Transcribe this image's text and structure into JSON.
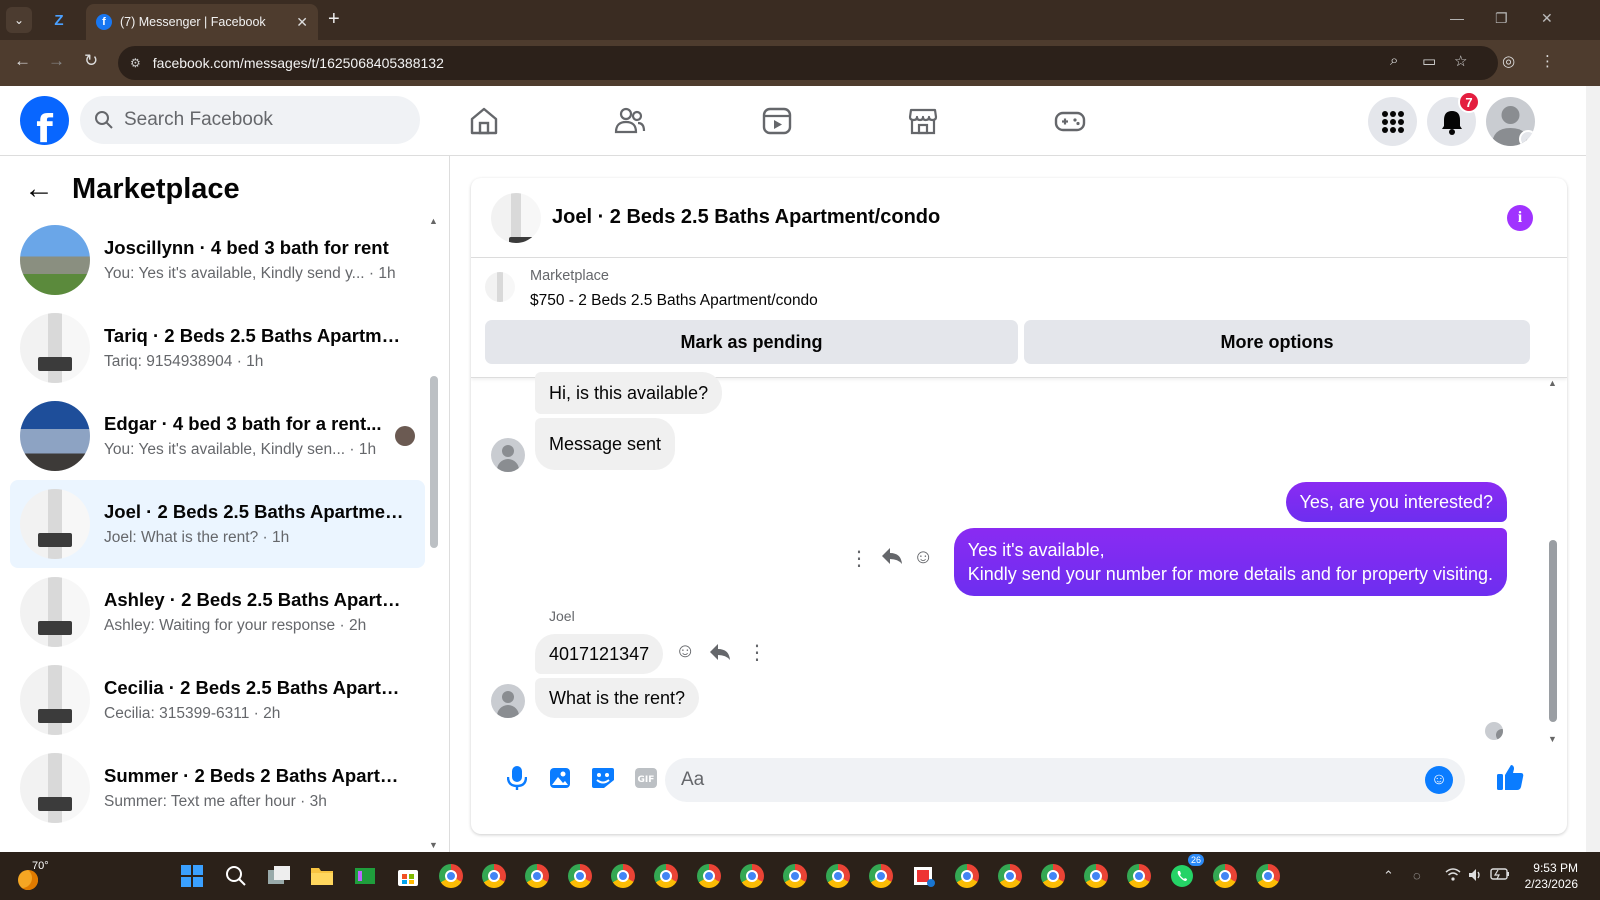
{
  "browser": {
    "tab_title": "(7) Messenger | Facebook",
    "url": "facebook.com/messages/t/1625068405388132"
  },
  "header": {
    "search_placeholder": "Search Facebook",
    "notification_count": "7"
  },
  "sidebar": {
    "title": "Marketplace",
    "conversations": [
      {
        "name": "Joscillynn · 4 bed 3 bath for rent",
        "preview": "You: Yes it's available, Kindly send y...  · 1h",
        "thumb": "house"
      },
      {
        "name": "Tariq · 2 Beds 2.5 Baths Apartme...",
        "preview": "Tariq: 9154938904 · 1h",
        "thumb": "interior"
      },
      {
        "name": "Edgar · 4 bed 3 bath for a rent...",
        "preview": "You: Yes it's available, Kindly sen...  · 1h",
        "thumb": "blue"
      },
      {
        "name": "Joel · 2 Beds 2.5 Baths Apartmen...",
        "preview": "Joel: What is the rent? · 1h",
        "thumb": "interior"
      },
      {
        "name": "Ashley · 2 Beds 2.5 Baths Apartm...",
        "preview": "Ashley: Waiting for your response · 2h",
        "thumb": "interior"
      },
      {
        "name": "Cecilia · 2 Beds 2.5 Baths Apartm...",
        "preview": "Cecilia: 315399-6311 · 2h",
        "thumb": "interior"
      },
      {
        "name": "Summer · 2 Beds 2 Baths Apartm...",
        "preview": "Summer: Text me after hour · 3h",
        "thumb": "interior"
      }
    ]
  },
  "chat": {
    "title": "Joel · 2 Beds 2.5 Baths Apartment/condo",
    "listing_label": "Marketplace",
    "listing_item": "$750 - 2 Beds 2.5 Baths Apartment/condo",
    "mark_pending_label": "Mark as pending",
    "more_options_label": "More options",
    "messages": {
      "m1": "Hi, is this available?",
      "m2": "Message sent",
      "m3": "Yes, are you interested?",
      "m4_line1": "Yes it's available,",
      "m4_line2": "Kindly send your number for more details and for property visiting.",
      "sender": "Joel",
      "m5": "4017121347",
      "m6": "What is the rent?"
    },
    "composer_placeholder": "Aa"
  },
  "taskbar": {
    "temperature": "70°",
    "time": "9:53 PM",
    "date": "2/23/2026",
    "whatsapp_badge": "26"
  }
}
